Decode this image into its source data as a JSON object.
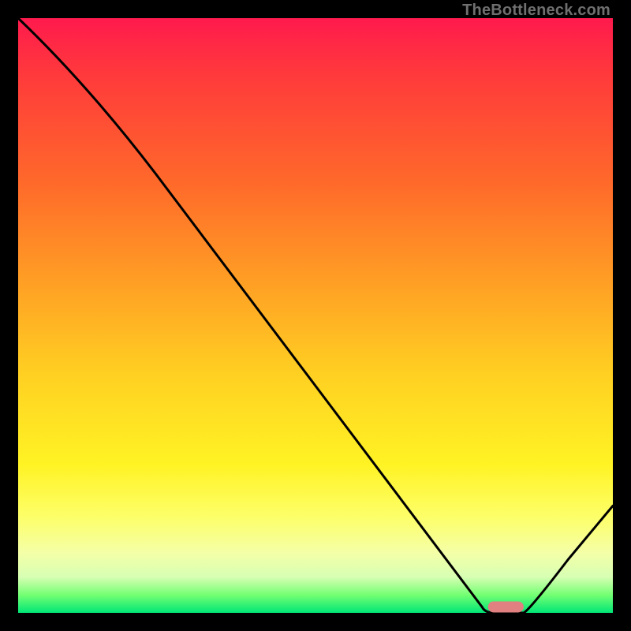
{
  "attribution": "TheBottleneck.com",
  "chart_data": {
    "type": "line",
    "title": "",
    "xlabel": "",
    "ylabel": "",
    "x": [
      0.0,
      0.23,
      0.78,
      0.8,
      0.85,
      1.0
    ],
    "values": [
      1.0,
      0.74,
      0.01,
      0.0,
      0.0,
      0.18
    ],
    "xlim": [
      0,
      1
    ],
    "ylim": [
      0,
      1
    ],
    "marker": {
      "x_range": [
        0.79,
        0.85
      ],
      "y": 0.01,
      "color": "#e08080"
    },
    "gradient_background": {
      "top_color": "#ff1a4d",
      "mid_color": "#ffd022",
      "bottom_color": "#00e676"
    }
  }
}
